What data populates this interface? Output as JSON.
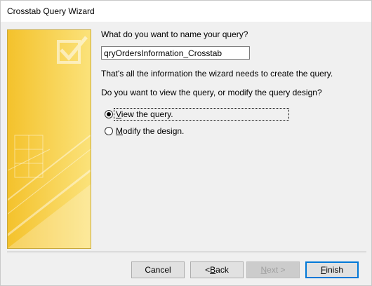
{
  "window": {
    "title": "Crosstab Query Wizard"
  },
  "art": {
    "accent": "#f7d54a",
    "icon": "checkbox-check-icon"
  },
  "main": {
    "name_question": "What do you want to name your query?",
    "query_name": "qryOrdersInformation_Crosstab",
    "info": "That's all the information the wizard needs to create the query.",
    "view_question": "Do you want to view the query, or modify the query design?",
    "options": [
      {
        "label_access": "V",
        "label_rest": "iew the query.",
        "selected": true
      },
      {
        "label_access": "M",
        "label_rest": "odify the design.",
        "selected": false
      }
    ]
  },
  "buttons": {
    "cancel": "Cancel",
    "back_prefix": "< ",
    "back_access": "B",
    "back_rest": "ack",
    "next_access": "N",
    "next_rest": "ext >",
    "finish_access": "F",
    "finish_rest": "inish"
  }
}
